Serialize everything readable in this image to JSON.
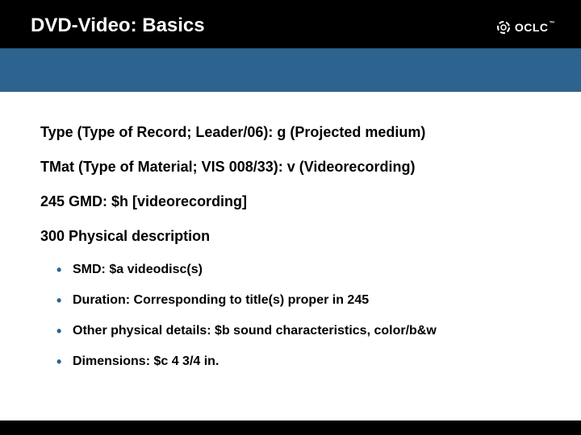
{
  "header": {
    "title": "DVD-Video:  Basics",
    "logo_text": "OCLC",
    "logo_tm": "™"
  },
  "content": {
    "line1": "Type (Type of Record; Leader/06):  g (Projected medium)",
    "line2": "TMat (Type of Material; VIS 008/33):  v (Videorecording)",
    "line3": "245  GMD:  $h [videorecording]",
    "line4": "300 Physical description",
    "bullets": [
      "SMD:  $a videodisc(s)",
      "Duration:  Corresponding to title(s) proper in 245",
      "Other physical details:  $b sound characteristics, color/b&w",
      "Dimensions:  $c 4 3/4 in."
    ]
  }
}
